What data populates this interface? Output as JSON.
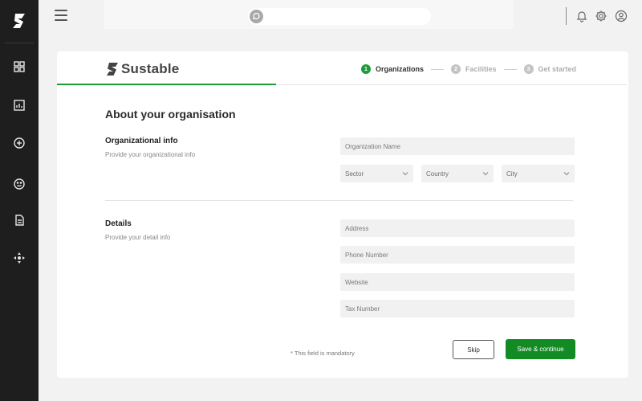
{
  "app": {
    "brand_name": "Sustable",
    "accent_color": "#1f9b3b",
    "button_color": "#138b25"
  },
  "sidebar": {
    "logo_icon": "sustable-logo-icon",
    "items": [
      {
        "name": "dashboard",
        "icon": "grid-icon"
      },
      {
        "name": "reports",
        "icon": "chart-icon"
      },
      {
        "name": "add",
        "icon": "plus-circle-icon"
      },
      {
        "name": "emissions",
        "icon": "smile-icon"
      },
      {
        "name": "documents",
        "icon": "document-icon"
      },
      {
        "name": "navigate",
        "icon": "move-icon"
      }
    ]
  },
  "topbar": {
    "menu_icon": "hamburger-icon",
    "search": {
      "placeholder": "",
      "value": "",
      "icon": "search-icon"
    },
    "icons": [
      "bell-icon",
      "gear-icon",
      "user-icon"
    ]
  },
  "stepper": {
    "steps": [
      {
        "number": "1",
        "label": "Organizations",
        "state": "active"
      },
      {
        "number": "2",
        "label": "Facilities",
        "state": "inactive"
      },
      {
        "number": "3",
        "label": "Get started",
        "state": "inactive"
      }
    ],
    "progress": 0.385
  },
  "form": {
    "title": "About your organisation",
    "org_section": {
      "title": "Organizational info",
      "subtitle": "Provide your organizational info",
      "org_name_placeholder": "Organization Name",
      "sector_label": "Sector",
      "country_label": "Country",
      "city_label": "City"
    },
    "details_section": {
      "title": "Details",
      "subtitle": "Provide your detail info",
      "address_placeholder": "Address",
      "phone_placeholder": "Phone Number",
      "website_placeholder": "Website",
      "tax_placeholder": "Tax Number"
    },
    "mandatory_note": "* This field is mandatory",
    "skip_label": "Skip",
    "save_label": "Save & continue"
  }
}
